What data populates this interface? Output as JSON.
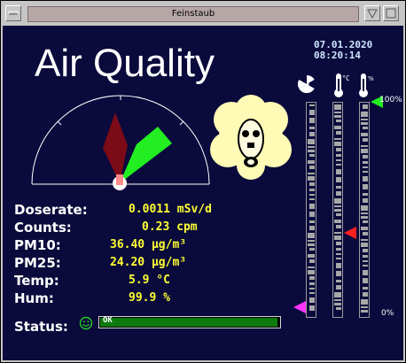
{
  "window": {
    "title": "Feinstaub"
  },
  "clock": {
    "date": "07.01.2020",
    "time": "08:20:14"
  },
  "heading": "Air Quality",
  "readings": [
    {
      "label": "Doserate:",
      "value": "0.0011 mSv/d"
    },
    {
      "label": "Counts:",
      "value": "0.23 cpm"
    },
    {
      "label": "PM10:",
      "value": "36.40 µg/m³"
    },
    {
      "label": "PM25:",
      "value": "24.20 µg/m³"
    },
    {
      "label": "Temp:",
      "value": "5.9 °C"
    },
    {
      "label": "Hum:",
      "value": "99.9 %"
    }
  ],
  "status": {
    "label": "Status:",
    "text": "OK",
    "icon": "smiley-icon",
    "color": "#0d7a0d"
  },
  "gauges": {
    "scale_top": "100%",
    "scale_bottom": "0%",
    "bar_radiation": {
      "icon": "radiation-icon",
      "marker_color": "#ff33ff",
      "level": 0.03
    },
    "bar_temperature": {
      "icon": "thermometer-icon",
      "marker_color": "#ff2020",
      "level": 0.34
    },
    "bar_humidity": {
      "icon": "humidity-thermometer-icon",
      "marker_color": "#22ee22",
      "level": 0.999
    }
  },
  "dial": {
    "needle_pm10_color": "#7a0b17",
    "needle_pm25_color": "#22ee22"
  },
  "colors": {
    "background": "#0a0a3c",
    "value_text": "#ffff33",
    "label_text": "#ffffff"
  }
}
